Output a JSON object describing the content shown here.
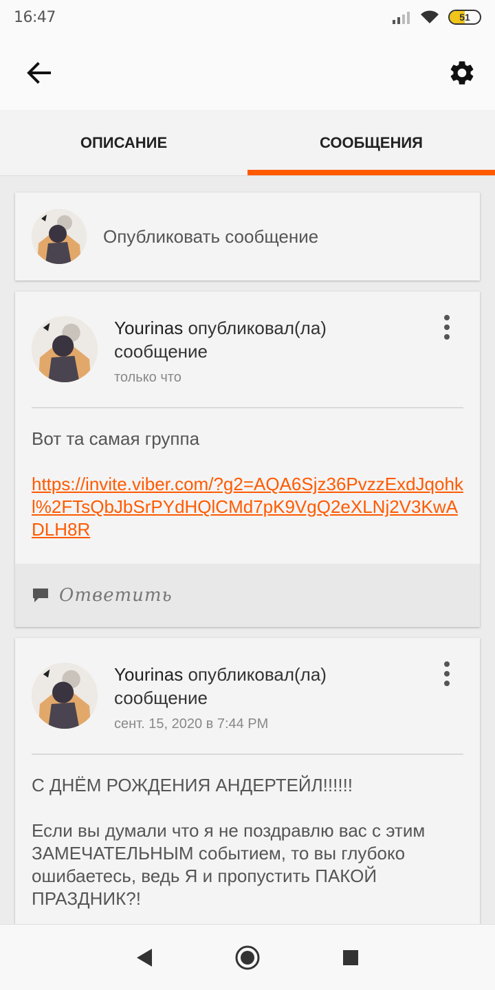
{
  "status_bar": {
    "time": "16:47",
    "battery": "51",
    "battery_level": 0.51
  },
  "app_bar": {
    "back_icon": "arrow-left-icon",
    "settings_icon": "gear-icon"
  },
  "tabs": [
    {
      "label": "ОПИСАНИЕ",
      "active": false
    },
    {
      "label": "СООБЩЕНИЯ",
      "active": true
    }
  ],
  "composer": {
    "label": "Опубликовать сообщение"
  },
  "messages": [
    {
      "author": "Yourinas",
      "action": "опубликовал(ла) сообщение",
      "time": "только что",
      "text": "Вот та самая группа",
      "link": "https://invite.viber.com/?g2=AQA6Sjz36PvzzExdJqohkl%2FTsQbJbSrPYdHQlCMd7pK9VgQ2eXLNj2V3KwADLH8R",
      "reply_label": "Ответить"
    },
    {
      "author": "Yourinas",
      "action": "опубликовал(ла) сообщение",
      "time": "сент. 15, 2020 в 7:44 PM",
      "text_title": "С ДНЁМ РОЖДЕНИЯ АНДЕРТЕЙЛ!!!!!!",
      "text": "Если вы думали что я не поздравлю вас с этим ЗАМЕЧАТЕЛЬНЫМ событием, то вы глубоко ошибаетесь, ведь Я и пропустить ПАКОЙ ПРАЗДНИК?!"
    }
  ],
  "colors": {
    "accent": "#ff5a00",
    "background": "#ececec",
    "card": "#f4f4f4"
  }
}
